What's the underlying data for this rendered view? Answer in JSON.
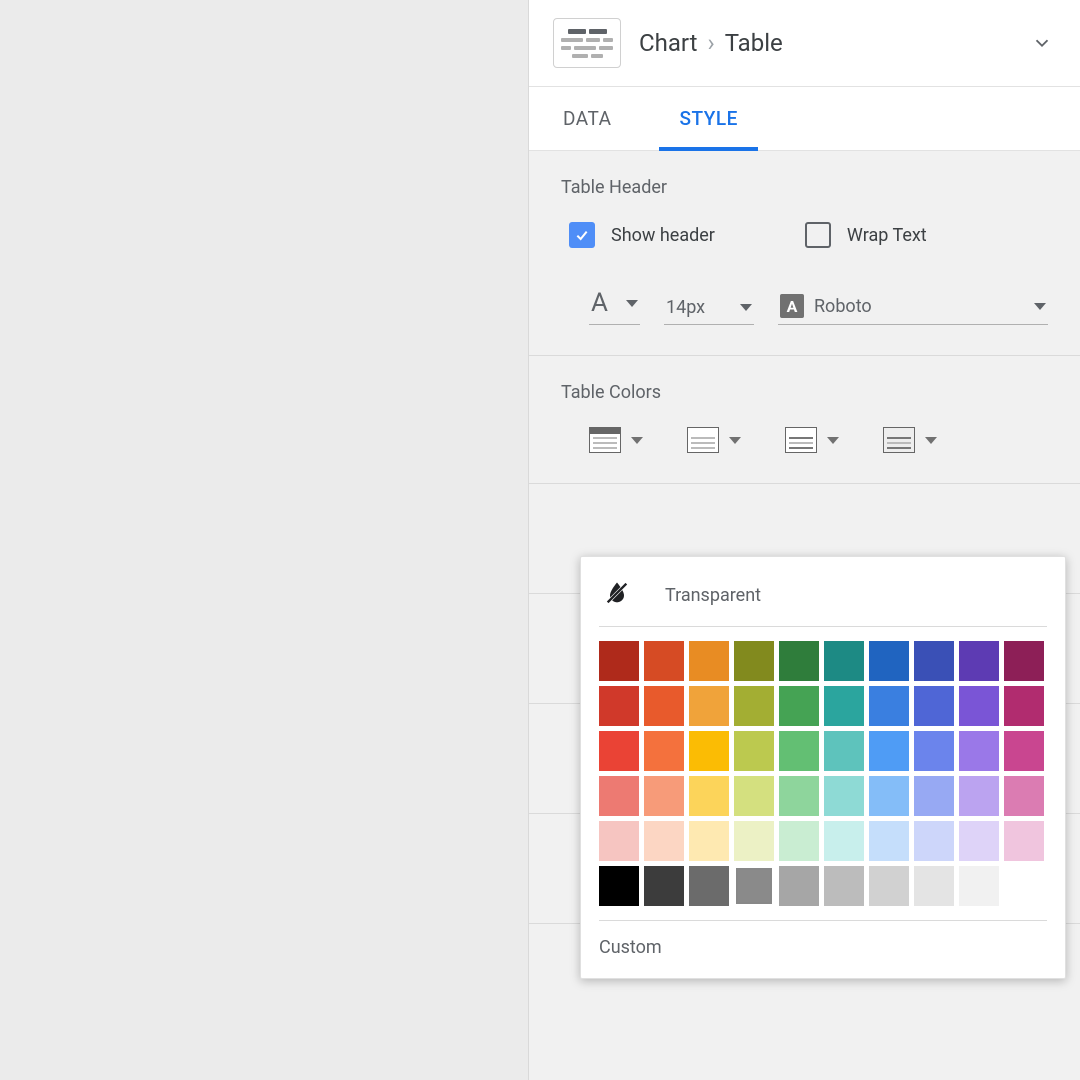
{
  "breadcrumb": {
    "l1": "Chart",
    "l2": "Table"
  },
  "tabs": {
    "data": "DATA",
    "style": "STYLE"
  },
  "header_section": {
    "title": "Table Header",
    "show_header": "Show header",
    "wrap_text": "Wrap Text",
    "font_size": "14px",
    "font_family": "Roboto"
  },
  "colors_section": {
    "title": "Table Colors"
  },
  "popover": {
    "transparent": "Transparent",
    "custom": "Custom",
    "selected_index": 53,
    "swatches": [
      "#af2a1b",
      "#d64b24",
      "#e88c23",
      "#828a1e",
      "#2f7d3b",
      "#1d8a84",
      "#2064c0",
      "#3a50b6",
      "#5d3bb3",
      "#8d1f57",
      "#d0392a",
      "#e85a2c",
      "#f0a33a",
      "#a3ae33",
      "#45a354",
      "#2ba59e",
      "#3a7fe0",
      "#4f66d6",
      "#7a55d6",
      "#b12c6f",
      "#ea4335",
      "#f4713d",
      "#fbbc04",
      "#bcc94f",
      "#63bf73",
      "#5ec3bc",
      "#4f9cf5",
      "#6b84ec",
      "#9a78e8",
      "#c94690",
      "#ed7a72",
      "#f79b79",
      "#fcd45a",
      "#d4e07f",
      "#8ed59c",
      "#8edad5",
      "#84bdf8",
      "#97a9f3",
      "#bba3f0",
      "#db7cb2",
      "#f6c5c1",
      "#fcd6c3",
      "#fee9b1",
      "#ecf1c5",
      "#c9edd2",
      "#c8efec",
      "#c5defb",
      "#cdd6fa",
      "#ded3f8",
      "#f0c5de",
      "#000000",
      "#3c3c3c",
      "#6b6b6b",
      "#8a8a8a",
      "#a6a6a6",
      "#bcbcbc",
      "#d1d1d1",
      "#e4e4e4",
      "#f1f1f1",
      "#ffffff"
    ]
  }
}
